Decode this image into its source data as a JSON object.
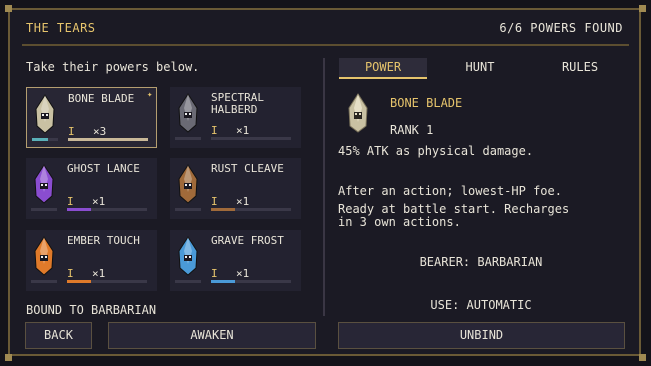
{
  "header": {
    "title": "THE TEARS",
    "count": "6/6 POWERS FOUND"
  },
  "left": {
    "hint": "Take their powers below.",
    "bound": "BOUND TO BARBARIAN",
    "cards": [
      {
        "name": "BONE BLADE",
        "rank": "I",
        "qty": "×3",
        "color": "#c9c1a3",
        "selected": true,
        "progress": 1.0
      },
      {
        "name": "SPECTRAL HALBERD",
        "rank": "I",
        "qty": "×1",
        "color": "#6a6a74",
        "selected": false,
        "progress": 0.0
      },
      {
        "name": "GHOST LANCE",
        "rank": "I",
        "qty": "×1",
        "color": "#8a4dd0",
        "selected": false,
        "progress": 0.3
      },
      {
        "name": "RUST CLEAVE",
        "rank": "I",
        "qty": "×1",
        "color": "#a06a3a",
        "selected": false,
        "progress": 0.3
      },
      {
        "name": "EMBER TOUCH",
        "rank": "I",
        "qty": "×1",
        "color": "#e07a2a",
        "selected": false,
        "progress": 0.3
      },
      {
        "name": "GRAVE FROST",
        "rank": "I",
        "qty": "×1",
        "color": "#4a9ad8",
        "selected": false,
        "progress": 0.3
      }
    ]
  },
  "tabs": [
    "POWER",
    "HUNT",
    "RULES"
  ],
  "detail": {
    "name": "BONE BLADE",
    "rank": "RANK 1",
    "effect": "45% ATK as physical damage.",
    "line1": "After an action; lowest-HP foe.",
    "line2": "Ready at battle start. Recharges",
    "line3": "in 3 own actions.",
    "bearer": "BEARER: BARBARIAN",
    "use": "USE: AUTOMATIC"
  },
  "buttons": {
    "back": "BACK",
    "awaken": "AWAKEN",
    "unbind": "UNBIND"
  }
}
